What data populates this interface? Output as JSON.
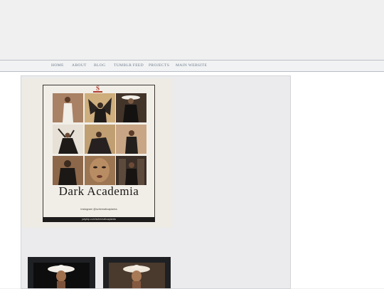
{
  "nav": {
    "items": [
      {
        "label": "HOME"
      },
      {
        "label": "ABOUT"
      },
      {
        "label": "BLOG"
      },
      {
        "label": "TUMBLR FEED"
      },
      {
        "label": "PROJECTS"
      },
      {
        "label": "MAIN WEBSITE"
      }
    ]
  },
  "poster": {
    "logo": "S",
    "title": "Dark Academia",
    "handle": "instagram @schematicaplanta",
    "footer": "payhip.com/schematicaplanta"
  },
  "colors": {
    "nav_text": "#6b7b8c",
    "panel_bg": "#ebebed",
    "poster_bg": "#eeebe5",
    "accent": "#b23a2b"
  }
}
